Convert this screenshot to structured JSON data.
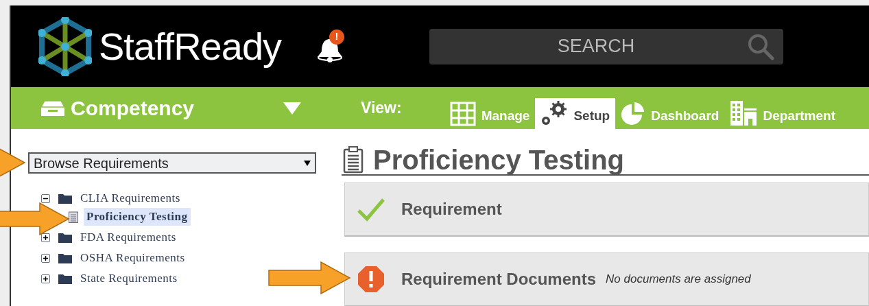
{
  "header": {
    "logo_text": "StaffReady",
    "notifications": {
      "alert": "!"
    },
    "search": {
      "placeholder": "SEARCH"
    }
  },
  "module_bar": {
    "module": "Competency",
    "view_label": "View:",
    "tabs": [
      {
        "label": "Manage",
        "selected": false
      },
      {
        "label": "Setup",
        "selected": true
      },
      {
        "label": "Dashboard",
        "selected": false
      },
      {
        "label": "Department",
        "selected": false
      }
    ]
  },
  "sidebar": {
    "dropdown": "Browse Requirements",
    "tree": [
      {
        "label": "CLIA Requirements",
        "kind": "folder",
        "expanded": true,
        "selected": false,
        "children": [
          {
            "label": "Proficiency Testing",
            "kind": "document",
            "selected": true
          }
        ]
      },
      {
        "label": "FDA Requirements",
        "kind": "folder",
        "expanded": false,
        "selected": false
      },
      {
        "label": "OSHA Requirements",
        "kind": "folder",
        "expanded": false,
        "selected": false
      },
      {
        "label": "State Requirements",
        "kind": "folder",
        "expanded": false,
        "selected": false
      }
    ]
  },
  "content": {
    "title": "Proficiency Testing",
    "sections": [
      {
        "title": "Requirement",
        "kind": "ok"
      },
      {
        "title": "Requirement Documents",
        "kind": "error",
        "note": "No documents are assigned"
      }
    ]
  }
}
